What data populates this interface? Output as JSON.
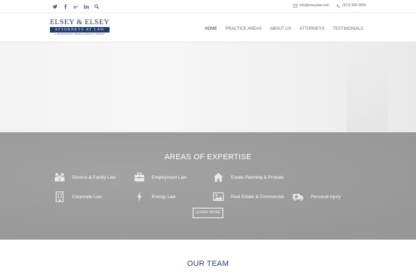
{
  "topbar": {
    "social": [
      "twitter-icon",
      "facebook-icon",
      "google-plus-icon",
      "linkedin-icon",
      "search-icon"
    ],
    "email": "info@elseylaw.com",
    "phone": "(972) 906-9695"
  },
  "logo": {
    "name": "ELSEY & ELSEY",
    "band": "ATTORNEYS AT LAW",
    "sub": "A PROFESSIONAL LIMITED LIABILITY COMPANY"
  },
  "nav": {
    "items": [
      "HOME",
      "PRACTICE AREAS",
      "ABOUT US",
      "ATTORNEYS",
      "TESTIMONIALS"
    ],
    "active": "HOME"
  },
  "expertise": {
    "title": "AREAS OF EXPERTISE",
    "items": [
      {
        "label": "Divorce & Family Law",
        "icon": "family-icon"
      },
      {
        "label": "Employment Law",
        "icon": "briefcase-icon"
      },
      {
        "label": "Estate Planning & Probate",
        "icon": "house-icon"
      },
      {
        "label": "Corporate Law",
        "icon": "building-icon"
      },
      {
        "label": "Energy Law",
        "icon": "lightning-icon"
      },
      {
        "label": "Real Estate & Commercial",
        "icon": "picture-icon"
      },
      {
        "label": "Personal Injury",
        "icon": "ambulance-icon"
      }
    ],
    "button": "LEARN MORE"
  },
  "team": {
    "title": "OUR TEAM"
  },
  "colors": {
    "brand": "#1f3d6e",
    "expertise_bg": "#9c9c9c",
    "nav_text": "#5a6b86"
  }
}
